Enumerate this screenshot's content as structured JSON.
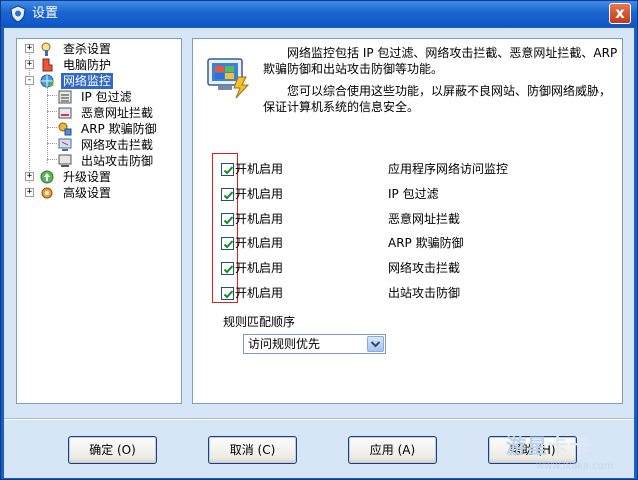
{
  "window": {
    "title": "设置",
    "close_glyph": "x"
  },
  "tree": {
    "items": [
      {
        "label": "查杀设置",
        "icon": "scan-settings-icon",
        "expander": "+"
      },
      {
        "label": "电脑防护",
        "icon": "pc-protection-icon",
        "expander": "+"
      },
      {
        "label": "网络监控",
        "icon": "network-monitor-icon",
        "expander": "-"
      },
      {
        "label": "IP 包过滤",
        "icon": "ip-filter-icon"
      },
      {
        "label": "恶意网址拦截",
        "icon": "url-block-icon"
      },
      {
        "label": "ARP 欺骗防御",
        "icon": "arp-defense-icon"
      },
      {
        "label": "网络攻击拦截",
        "icon": "attack-block-icon"
      },
      {
        "label": "出站攻击防御",
        "icon": "outbound-defense-icon"
      },
      {
        "label": "升级设置",
        "icon": "upgrade-settings-icon",
        "expander": "+"
      },
      {
        "label": "高级设置",
        "icon": "advanced-settings-icon",
        "expander": "+"
      }
    ]
  },
  "main": {
    "description_1": "网络监控包括 IP 包过滤、网络攻击拦截、恶意网址拦截、ARP 欺骗防御和出站攻击防御等功能。",
    "description_2": "您可以综合使用这些功能，以屏蔽不良网站、防御网络威胁，保证计算机系统的信息安全。",
    "options": [
      {
        "checkbox_label": "开机启用",
        "feature": "应用程序网络访问监控",
        "checked": true
      },
      {
        "checkbox_label": "开机启用",
        "feature": "IP 包过滤",
        "checked": true
      },
      {
        "checkbox_label": "开机启用",
        "feature": "恶意网址拦截",
        "checked": true
      },
      {
        "checkbox_label": "开机启用",
        "feature": "ARP 欺骗防御",
        "checked": true
      },
      {
        "checkbox_label": "开机启用",
        "feature": "网络攻击拦截",
        "checked": true
      },
      {
        "checkbox_label": "开机启用",
        "feature": "出站攻击防御",
        "checked": true
      }
    ],
    "rule_order_label": "规则匹配顺序",
    "rule_order_value": "访问规则优先"
  },
  "buttons": {
    "ok": "确定 (O)",
    "cancel": "取消 (C)",
    "apply": "应用 (A)",
    "help": "帮助 (H)"
  },
  "watermark": {
    "logo_a": "游星",
    "logo_b": "卡卡",
    "url": "www.ikaka.com"
  },
  "colors": {
    "title_bar": "#1a64d0",
    "client_bg": "#d6e6f7",
    "selection": "#316ac5",
    "highlight_box": "#d62020"
  }
}
